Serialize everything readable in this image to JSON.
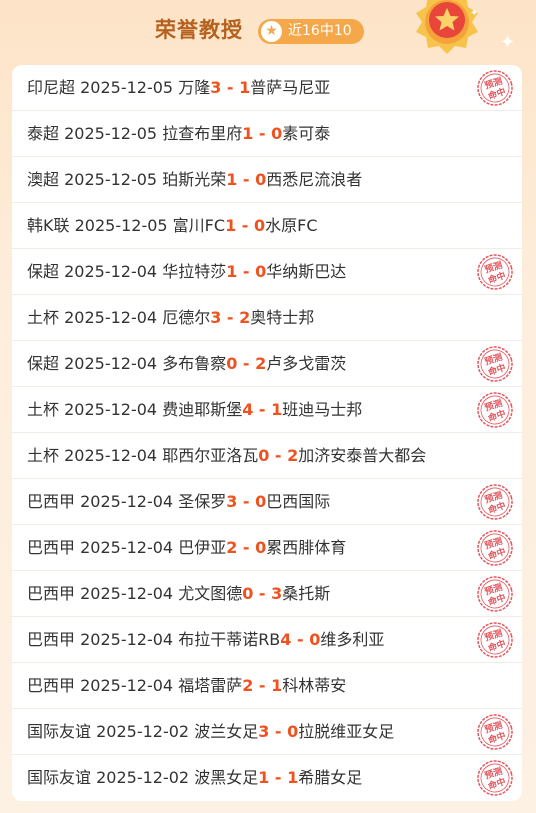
{
  "header": {
    "title": "荣誉教授",
    "badge_label": "近16中10"
  },
  "stamp_text": [
    "预测",
    "命中"
  ],
  "colors": {
    "accent_orange": "#f0521f",
    "title_brown": "#b6621e",
    "badge_bg": "#f5a84a",
    "stamp_red": "#e2585e"
  },
  "matches": [
    {
      "league": "印尼超",
      "date": "2025-12-05",
      "home": "万隆",
      "home_score": "3",
      "sep": "-",
      "away_score": "1",
      "away": "普萨马尼亚",
      "hit": true
    },
    {
      "league": "泰超",
      "date": "2025-12-05",
      "home": "拉查布里府",
      "home_score": "1",
      "sep": "-",
      "away_score": "0",
      "away": "素可泰",
      "hit": false
    },
    {
      "league": "澳超",
      "date": "2025-12-05",
      "home": "珀斯光荣",
      "home_score": "1",
      "sep": "-",
      "away_score": "0",
      "away": "西悉尼流浪者",
      "hit": false
    },
    {
      "league": "韩K联",
      "date": "2025-12-05",
      "home": "富川FC",
      "home_score": "1",
      "sep": "-",
      "away_score": "0",
      "away": "水原FC",
      "hit": false
    },
    {
      "league": "保超",
      "date": "2025-12-04",
      "home": "华拉特莎",
      "home_score": "1",
      "sep": "-",
      "away_score": "0",
      "away": "华纳斯巴达",
      "hit": true
    },
    {
      "league": "土杯",
      "date": "2025-12-04",
      "home": "厄德尔",
      "home_score": "3",
      "sep": "-",
      "away_score": "2",
      "away": "奥特士邦",
      "hit": false
    },
    {
      "league": "保超",
      "date": "2025-12-04",
      "home": "多布鲁察",
      "home_score": "0",
      "sep": "-",
      "away_score": "2",
      "away": "卢多戈雷茨",
      "hit": true
    },
    {
      "league": "土杯",
      "date": "2025-12-04",
      "home": "费迪耶斯堡",
      "home_score": "4",
      "sep": "-",
      "away_score": "1",
      "away": "班迪马士邦",
      "hit": true
    },
    {
      "league": "土杯",
      "date": "2025-12-04",
      "home": "耶西尔亚洛瓦",
      "home_score": "0",
      "sep": "-",
      "away_score": "2",
      "away": "加济安泰普大都会",
      "hit": false
    },
    {
      "league": "巴西甲",
      "date": "2025-12-04",
      "home": "圣保罗",
      "home_score": "3",
      "sep": "-",
      "away_score": "0",
      "away": "巴西国际",
      "hit": true
    },
    {
      "league": "巴西甲",
      "date": "2025-12-04",
      "home": "巴伊亚",
      "home_score": "2",
      "sep": "-",
      "away_score": "0",
      "away": "累西腓体育",
      "hit": true
    },
    {
      "league": "巴西甲",
      "date": "2025-12-04",
      "home": "尤文图德",
      "home_score": "0",
      "sep": "-",
      "away_score": "3",
      "away": "桑托斯",
      "hit": true
    },
    {
      "league": "巴西甲",
      "date": "2025-12-04",
      "home": "布拉干蒂诺RB",
      "home_score": "4",
      "sep": "-",
      "away_score": "0",
      "away": "维多利亚",
      "hit": true
    },
    {
      "league": "巴西甲",
      "date": "2025-12-04",
      "home": "福塔雷萨",
      "home_score": "2",
      "sep": "-",
      "away_score": "1",
      "away": "科林蒂安",
      "hit": false
    },
    {
      "league": "国际友谊",
      "date": "2025-12-02",
      "home": "波兰女足",
      "home_score": "3",
      "sep": "-",
      "away_score": "0",
      "away": "拉脱维亚女足",
      "hit": true
    },
    {
      "league": "国际友谊",
      "date": "2025-12-02",
      "home": "波黑女足",
      "home_score": "1",
      "sep": "-",
      "away_score": "1",
      "away": "希腊女足",
      "hit": true
    }
  ]
}
